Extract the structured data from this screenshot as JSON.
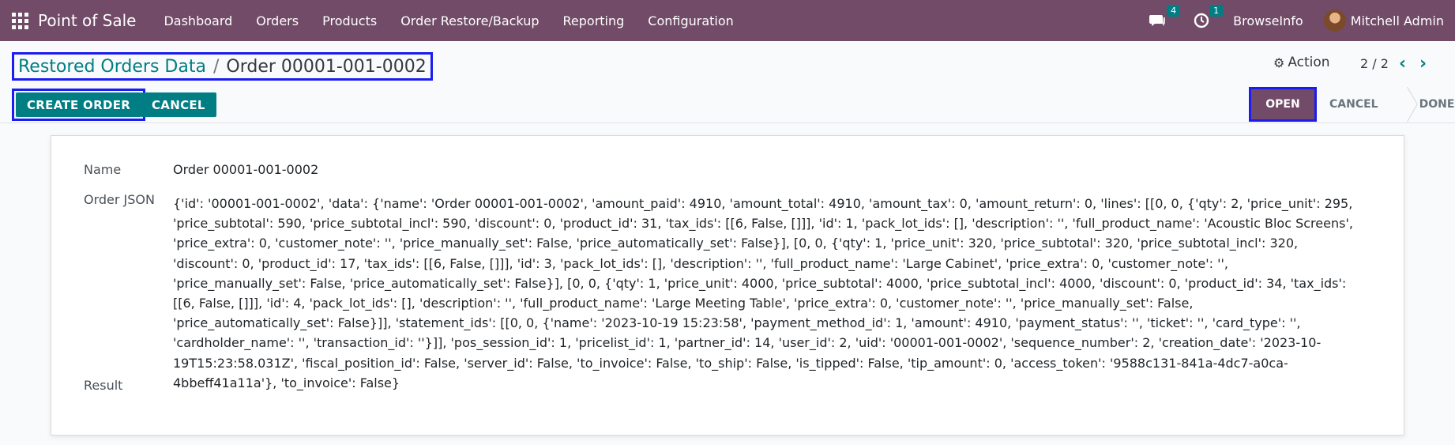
{
  "navbar": {
    "app_name": "Point of Sale",
    "menu": [
      "Dashboard",
      "Orders",
      "Products",
      "Order Restore/Backup",
      "Reporting",
      "Configuration"
    ],
    "messages_count": "4",
    "activities_count": "1",
    "company": "BrowseInfo",
    "user": "Mitchell Admin",
    "color": "#714b67"
  },
  "breadcrumb": {
    "parent": "Restored Orders Data",
    "separator": "/",
    "current": "Order 00001-001-0002"
  },
  "control": {
    "action_label": "Action",
    "pager": "2 / 2",
    "create_order_label": "CREATE ORDER",
    "cancel_label": "CANCEL"
  },
  "statusbar": {
    "stages": [
      "OPEN",
      "CANCEL",
      "DONE"
    ],
    "active": "OPEN"
  },
  "form": {
    "name_label": "Name",
    "name_value": "Order 00001-001-0002",
    "json_label": "Order JSON",
    "json_value": "{'id': '00001-001-0002', 'data': {'name': 'Order 00001-001-0002', 'amount_paid': 4910, 'amount_total': 4910, 'amount_tax': 0, 'amount_return': 0, 'lines': [[0, 0, {'qty': 2, 'price_unit': 295, 'price_subtotal': 590, 'price_subtotal_incl': 590, 'discount': 0, 'product_id': 31, 'tax_ids': [[6, False, []]], 'id': 1, 'pack_lot_ids': [], 'description': '', 'full_product_name': 'Acoustic Bloc Screens', 'price_extra': 0, 'customer_note': '', 'price_manually_set': False, 'price_automatically_set': False}], [0, 0, {'qty': 1, 'price_unit': 320, 'price_subtotal': 320, 'price_subtotal_incl': 320, 'discount': 0, 'product_id': 17, 'tax_ids': [[6, False, []]], 'id': 3, 'pack_lot_ids': [], 'description': '', 'full_product_name': 'Large Cabinet', 'price_extra': 0, 'customer_note': '', 'price_manually_set': False, 'price_automatically_set': False}], [0, 0, {'qty': 1, 'price_unit': 4000, 'price_subtotal': 4000, 'price_subtotal_incl': 4000, 'discount': 0, 'product_id': 34, 'tax_ids': [[6, False, []]], 'id': 4, 'pack_lot_ids': [], 'description': '', 'full_product_name': 'Large Meeting Table', 'price_extra': 0, 'customer_note': '', 'price_manually_set': False, 'price_automatically_set': False}]], 'statement_ids': [[0, 0, {'name': '2023-10-19 15:23:58', 'payment_method_id': 1, 'amount': 4910, 'payment_status': '', 'ticket': '', 'card_type': '', 'cardholder_name': '', 'transaction_id': ''}]], 'pos_session_id': 1, 'pricelist_id': 1, 'partner_id': 14, 'user_id': 2, 'uid': '00001-001-0002', 'sequence_number': 2, 'creation_date': '2023-10-19T15:23:58.031Z', 'fiscal_position_id': False, 'server_id': False, 'to_invoice': False, 'to_ship': False, 'is_tipped': False, 'tip_amount': 0, 'access_token': '9588c131-841a-4dc7-a0ca-4bbeff41a11a'}, 'to_invoice': False}",
    "result_label": "Result",
    "result_value": ""
  },
  "icons": {
    "apps": "apps-grid-icon",
    "messages": "chat-bubble-icon",
    "activities": "clock-icon",
    "action": "gear-icon",
    "prev": "chevron-left-icon",
    "next": "chevron-right-icon"
  }
}
